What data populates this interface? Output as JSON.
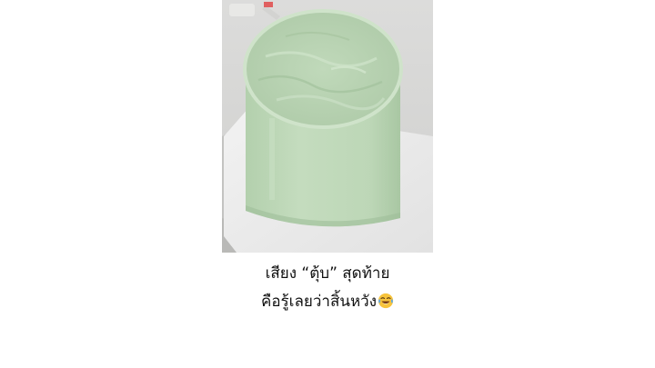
{
  "caption": {
    "line1": "เสียง “ตุ้บ” สุดท้าย",
    "line2": "คือรู้เลยว่าสิ้นหวัง"
  },
  "caption_emoji": "face-with-tears-of-joy-icon",
  "photo": {
    "subject": "mint-green-frosted-cake",
    "colors": {
      "frosting": "#bcd6b6",
      "frosting_shadow": "#a8c6a2",
      "board": "#eeeeee",
      "background": "#d9d8d6"
    }
  }
}
